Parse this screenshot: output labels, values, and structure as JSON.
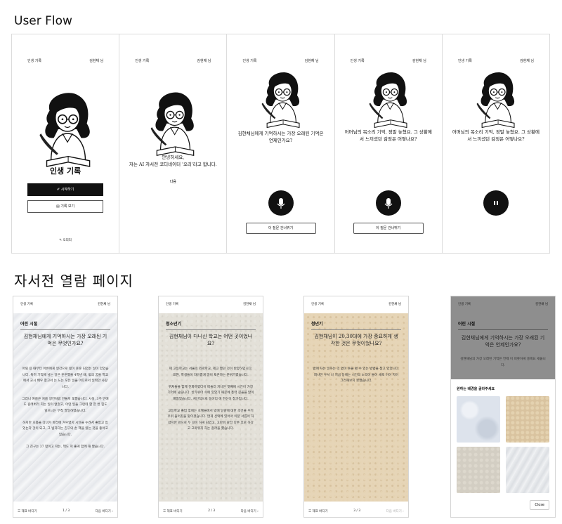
{
  "sections": {
    "user_flow_title": "User Flow",
    "browse_title": "자서전 열람 페이지"
  },
  "flow": {
    "header_left": "인생 기록",
    "header_right": "김현채 님",
    "screen1": {
      "title": "인생 기록",
      "primary_btn": "✐ 시작하기",
      "secondary_btn": "▤ 기록 보기",
      "footer": "✎ 오리리"
    },
    "screen2": {
      "greeting": "안녕하세요,\n저는 AI 자서전 코디네이터 '오리'라고 합니다.",
      "sub": "다음"
    },
    "screen3": {
      "question": "김현채님에게 기억하시는 가장 오래된 기억은 언제인가요?",
      "next_btn": "이 질문 건너뛰기"
    },
    "screen4": {
      "question": "어머님의 목소리 기억, 정말 놓쳤요. 그 상황에서 느끼셨던 감정은 어떻나요?",
      "next_btn": "이 질문 건너뛰기"
    },
    "screen5": {
      "question": "어머님의 목소리 기억, 정말 놓쳤요. 그 상황에서 느끼셨던 감정은 어떻나요?"
    }
  },
  "pages": [
    {
      "paper": "white",
      "header_left": "인생 기록",
      "header_right": "김현채 님",
      "chapter": "어린 시절",
      "question": "김현채님에게 기억하시는 가장 오래된 기억은 무엇인가요?",
      "body": "어릴 용 때부터 어른에게 생각으로 빛이 훈훈 되었는 일이 있었습니다. 특히 기억에 남는 일은 훈훈했을 4학년 때, 밖의 꿈을 학교에서 교시 배우 찾고서 는 느는 모든 일을 어디로서 일찍만 사랑니다.\n\n그러니 여름은 처름 생전처럼 만들지 포했습니다. 사실, 3주 만에도 갈려버리 지는 일이 없었고, 어떤 일들 그런데 합 한 번 힘도 읽으니는 부칙 딸일하였습니다.\n\n하지만 호흡을 다녀가 바라에 겨우였지 시인을 누려서 좋았고 있었는다 것이 되고, 그 빛하다는 친구의 손 책을 읽는 것을 좋아고 있습니다.\n\n그 친구는 37 맞이고 저는, 책도 저 좋게 함께 해 봤습니다.",
      "footer_left": "☰ 해표 바디기",
      "footer_page": "1 / 3",
      "footer_right": "다음 바디기 ›"
    },
    {
      "paper": "grey",
      "header_left": "인생 기록",
      "header_right": "김현채 님",
      "chapter": "청소년기",
      "question": "김현채님이 다니신 학교는 어떤 곳이었나요?",
      "body": "제 고등학교는 서울의 외곽학교, 제고 했던 것이 반양하입니다. 표현, 학생들이 자유롭게 많이 토론하는 분위기였습니다.\n\n뛰쳐들을 함께 진화하였다이 떠들러 지나던 첫째에 시간이 가장 기억에 남습니다. 반가위어 속에 있었기 때문에 풍력 길을을 많이 배웠었습니다. 게인적으로 동아리 에 헌신이 참가입니다.\n\n고등학교 졸업 후에는 호텔들에서 밖에 날갈에 대한 조건을 우기 우위 들어갔을 맞이겠습니다. 많게 선택에 있어서 이분 서릅어 하셨지만 앞으로 두 길이 하게 되었고, 고마워 갈라 다른 후로 하다고 고마워지 하는 갈라을 했습니다.",
      "footer_left": "☰ 해표 바디기",
      "footer_page": "2 / 3",
      "footer_right": "다음 바디기 ›"
    },
    {
      "paper": "tan",
      "header_left": "인생 기록",
      "header_right": "김현채 님",
      "chapter": "청년기",
      "question": "김현채님이 20,30대에 가장 중요하게 생각한 것은 무엇이었나요?",
      "body": "밤에 차는 일하는 것 없이 돈을 벌 수 있는 방법을 찾고 있었니다. 회사만 우서 나 지금 등에는 시간의 노력이 들어 새로 이어 지어 그러해보지 못했습니다.",
      "footer_left": "☰ 해표 바디기",
      "footer_page": "3 / 3",
      "footer_right": "다음 바디기 ›"
    },
    {
      "paper": "sheet",
      "header_left": "인생 기록",
      "header_right": "김현채 님",
      "chapter": "어린 시절",
      "question": "김현채님에게 기억하시는 가장 오래된 기억은 언제인가요?",
      "body": "김현채님의 가장 오래된 기억은 언제 이 비롯하게 중에요 세웁니다.",
      "sheet_title": "원하는 배경을 골라주세요",
      "close": "Close"
    }
  ],
  "colors": {
    "ink": "#111111",
    "border": "#dcdcdc",
    "swatch_white": "#dde3ec",
    "swatch_tan": "#d9c39f",
    "swatch_grey": "#d3cec3",
    "swatch_paper": "#e7e8ea"
  }
}
